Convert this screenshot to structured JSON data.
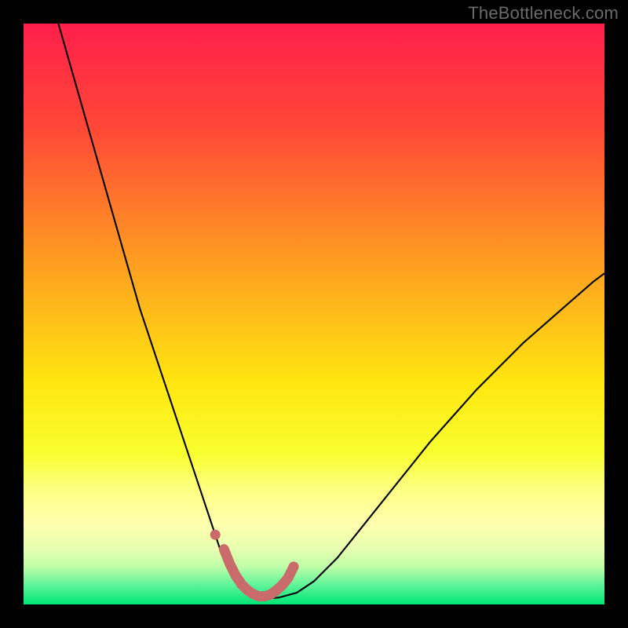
{
  "watermark": "TheBottleneck.com",
  "chart_data": {
    "type": "line",
    "title": "",
    "xlabel": "",
    "ylabel": "",
    "xlim": [
      0,
      100
    ],
    "ylim": [
      0,
      100
    ],
    "grid": false,
    "legend": false,
    "background_gradient": {
      "stops": [
        {
          "offset": 0.0,
          "color": "#ff1f4b"
        },
        {
          "offset": 0.18,
          "color": "#ff4837"
        },
        {
          "offset": 0.4,
          "color": "#ff9a22"
        },
        {
          "offset": 0.62,
          "color": "#ffe710"
        },
        {
          "offset": 0.74,
          "color": "#f8ff2f"
        },
        {
          "offset": 0.8,
          "color": "#fdff80"
        },
        {
          "offset": 0.86,
          "color": "#ffffad"
        },
        {
          "offset": 0.905,
          "color": "#e7ffb0"
        },
        {
          "offset": 0.935,
          "color": "#bfffa8"
        },
        {
          "offset": 0.965,
          "color": "#63f59b"
        },
        {
          "offset": 1.0,
          "color": "#00e676"
        }
      ]
    },
    "series": [
      {
        "name": "bottleneck-curve",
        "stroke": "#000000",
        "stroke_width": 2.1,
        "x": [
          6,
          8,
          10,
          12,
          14,
          16,
          18,
          20,
          22,
          24,
          26,
          28,
          30,
          31,
          32,
          33,
          34,
          35,
          36,
          37,
          38,
          39,
          40,
          42,
          44,
          47,
          50,
          54,
          58,
          62,
          66,
          70,
          74,
          78,
          82,
          86,
          90,
          94,
          98,
          100
        ],
        "y": [
          100,
          93,
          86,
          79,
          72,
          65,
          58,
          51,
          45,
          39,
          33,
          27,
          21,
          18,
          15,
          12,
          9,
          6.5,
          4.5,
          3,
          2,
          1.4,
          1.0,
          1.0,
          1.2,
          2,
          4,
          8,
          13,
          18,
          23,
          28,
          32.5,
          37,
          41,
          45,
          48.5,
          52,
          55.5,
          57
        ]
      },
      {
        "name": "optimum-marker",
        "stroke": "#c96b6b",
        "stroke_width": 13,
        "linecap": "round",
        "x": [
          34.5,
          35.5,
          36.5,
          37.5,
          38.5,
          39.5,
          40.5,
          41.5,
          42.5,
          43.5,
          44.5,
          45.5,
          46.5
        ],
        "y": [
          9.5,
          7.0,
          5.0,
          3.5,
          2.5,
          1.8,
          1.4,
          1.4,
          1.7,
          2.4,
          3.3,
          4.5,
          6.5
        ]
      }
    ],
    "points": [
      {
        "name": "optimum-dot-left",
        "x": 33.0,
        "y": 12.0,
        "r": 6.5,
        "color": "#c96b6b"
      }
    ]
  }
}
